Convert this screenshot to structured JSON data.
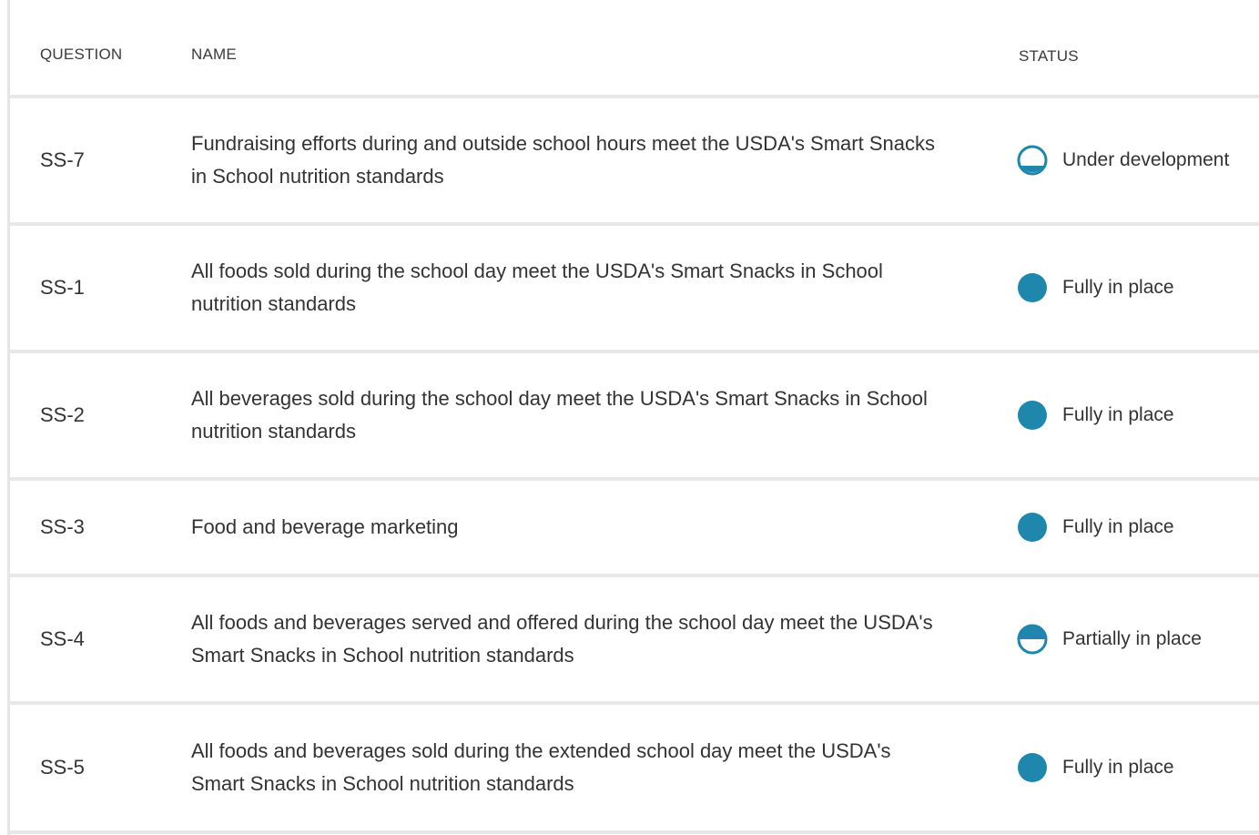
{
  "header": {
    "question": "QUESTION",
    "name": "NAME",
    "status": "STATUS"
  },
  "colors": {
    "accent": "#1f87ac",
    "divider": "#e8e8e8",
    "text": "#333333"
  },
  "rows": [
    {
      "question": "SS-7",
      "name": "Fundraising efforts during and outside school hours meet the USDA's Smart Snacks in School nutrition standards",
      "status": "Under development",
      "status_icon": "status-under-development-icon"
    },
    {
      "question": "SS-1",
      "name": "All foods sold during the school day meet the USDA's Smart Snacks in School nutrition standards",
      "status": "Fully in place",
      "status_icon": "status-fully-in-place-icon"
    },
    {
      "question": "SS-2",
      "name": "All beverages sold during the school day meet the USDA's Smart Snacks in School nutrition standards",
      "status": "Fully in place",
      "status_icon": "status-fully-in-place-icon"
    },
    {
      "question": "SS-3",
      "name": "Food and beverage marketing",
      "status": "Fully in place",
      "status_icon": "status-fully-in-place-icon"
    },
    {
      "question": "SS-4",
      "name": "All foods and beverages served and offered during the school day meet the USDA's Smart Snacks in School nutrition standards",
      "status": "Partially in place",
      "status_icon": "status-partially-in-place-icon"
    },
    {
      "question": "SS-5",
      "name": "All foods and beverages sold during the extended school day meet the USDA's Smart Snacks in School nutrition standards",
      "status": "Fully in place",
      "status_icon": "status-fully-in-place-icon"
    }
  ]
}
